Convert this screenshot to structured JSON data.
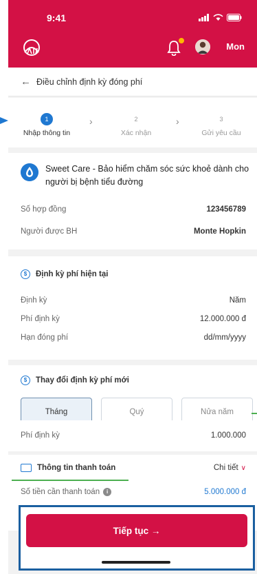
{
  "status_bar": {
    "time": "9:41"
  },
  "header": {
    "user_name": "Mon"
  },
  "title_bar": {
    "title": "Điều chỉnh định kỳ đóng phí"
  },
  "stepper": {
    "steps": [
      {
        "number": "1",
        "label": "Nhập thông tin"
      },
      {
        "number": "2",
        "label": "Xác nhận"
      },
      {
        "number": "3",
        "label": "Gửi yêu cầu"
      }
    ]
  },
  "product": {
    "name": "Sweet Care - Bảo hiểm chăm sóc sức khoẻ dành cho người bị bệnh tiểu đường",
    "contract_label": "Số hợp đồng",
    "contract_value": "123456789",
    "insured_label": "Người được BH",
    "insured_value": "Monte Hopkin"
  },
  "current_period": {
    "heading": "Định kỳ phí hiện tại",
    "rows": [
      {
        "label": "Định kỳ",
        "value": "Năm"
      },
      {
        "label": "Phí định kỳ",
        "value": "12.000.000 đ"
      },
      {
        "label": "Hạn đóng phí",
        "value": "dd/mm/yyyy"
      }
    ]
  },
  "change_period": {
    "heading": "Thay đổi định kỳ phí mới",
    "options": [
      "Tháng",
      "Quý",
      "Nửa năm"
    ],
    "selected": "Tháng",
    "fee_label": "Phí định kỳ",
    "fee_value": "1.000.000"
  },
  "payment": {
    "heading": "Thông tin thanh toán",
    "detail_label": "Chi tiết",
    "amount_label": "Số tiền cần thanh toán",
    "amount_value": "5.000.000 đ"
  },
  "cta": {
    "label": "Tiếp tục →"
  },
  "colors": {
    "brand_red": "#d31145",
    "accent_blue": "#1f78d1",
    "highlight_border": "#1a5fa0"
  }
}
